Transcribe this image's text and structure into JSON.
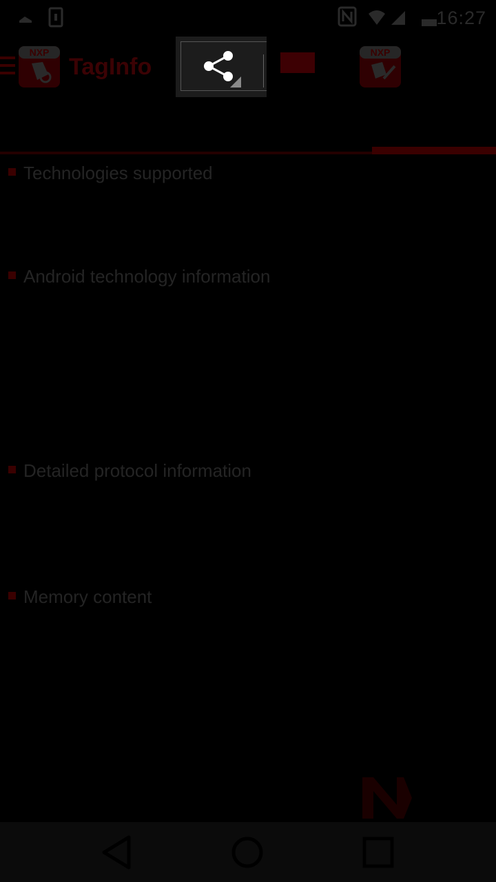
{
  "status_bar": {
    "time": "16:27",
    "icons": [
      "notification-icon",
      "sim-icon",
      "nfc-icon",
      "wifi-icon",
      "signal-icon",
      "battery-icon"
    ]
  },
  "header": {
    "app_title": "TagInfo",
    "menu_icon": "hamburger-menu-icon",
    "logo_icons": [
      "nxp-taginfo-logo-icon",
      "nxp-tagwriter-logo-icon"
    ]
  },
  "share_popup": {
    "icon": "share-icon"
  },
  "sections": [
    {
      "label": "Technologies supported"
    },
    {
      "label": "Android technology information"
    },
    {
      "label": "Detailed protocol information"
    },
    {
      "label": "Memory content"
    }
  ],
  "nav": {
    "icons": [
      "back-icon",
      "home-icon",
      "recents-icon"
    ]
  },
  "colors": {
    "background": "#000000",
    "brand_red_dimmed": "#3a0000",
    "text_dimmed": "#242424",
    "popup_bg": "#1c1c1c"
  }
}
